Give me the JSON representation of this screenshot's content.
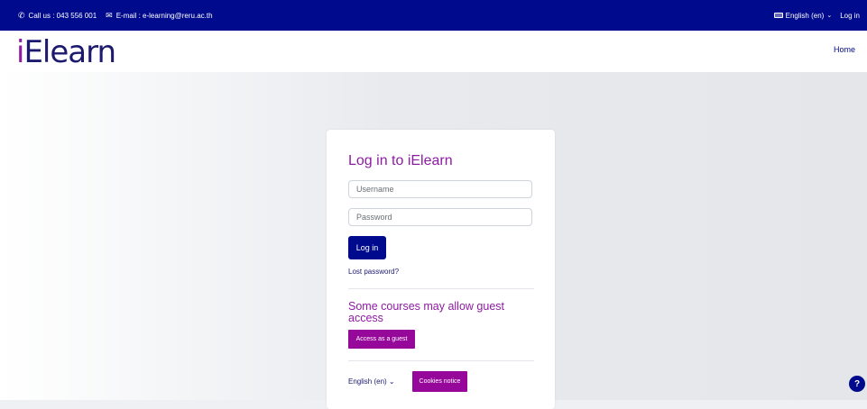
{
  "topbar": {
    "phone_text": "Call us : 043 556 001",
    "email_text": "E-mail : e-learning@reru.ac.th",
    "language": "English (en)",
    "login": "Log in"
  },
  "navbar": {
    "logo_i": "i",
    "logo_rest": "Elearn",
    "home": "Home"
  },
  "login": {
    "title": "Log in to iElearn",
    "username_placeholder": "Username",
    "password_placeholder": "Password",
    "login_button": "Log in",
    "lost_password": "Lost password?",
    "guest_heading": "Some courses may allow guest access",
    "guest_button": "Access as a guest",
    "language": "English (en)",
    "cookies_button": "Cookies notice"
  },
  "help": {
    "label": "?"
  },
  "colors": {
    "brand_navy": "#000a8c",
    "accent_purple": "#8e1ba3",
    "button_purple": "#96089a"
  }
}
